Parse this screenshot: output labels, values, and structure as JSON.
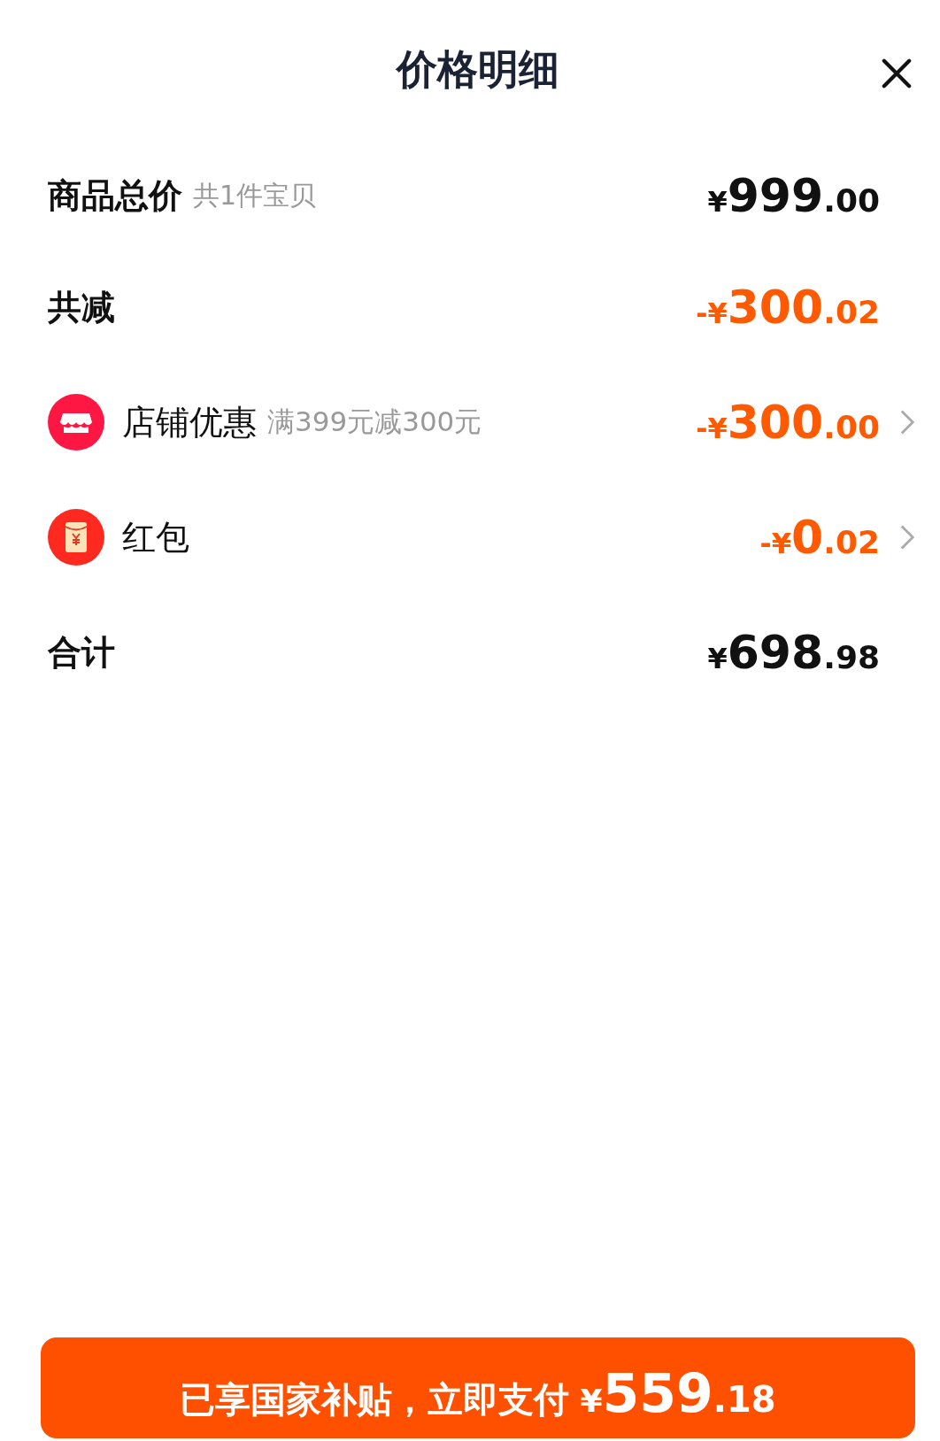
{
  "title": "价格明细",
  "rows": [
    {
      "kind": "plain",
      "label": "商品总价",
      "note": "共1件宝贝",
      "amount": {
        "currency": "¥",
        "integer": "999",
        "decimal": ".00"
      },
      "discount": false,
      "link": false
    },
    {
      "kind": "plain",
      "label": "共减",
      "amount": {
        "sign": "-",
        "currency": "¥",
        "integer": "300",
        "decimal": ".02"
      },
      "discount": true,
      "link": false
    },
    {
      "kind": "store",
      "label": "店铺优惠",
      "note": "满399元减300元",
      "amount": {
        "sign": "-",
        "currency": "¥",
        "integer": "300",
        "decimal": ".00"
      },
      "discount": true,
      "link": true
    },
    {
      "kind": "redpacket",
      "label": "红包",
      "amount": {
        "sign": "-",
        "currency": "¥",
        "integer": "0",
        "decimal": ".02"
      },
      "discount": true,
      "link": true
    },
    {
      "kind": "plain",
      "label": "合计",
      "amount": {
        "currency": "¥",
        "integer": "698",
        "decimal": ".98"
      },
      "discount": false,
      "link": false
    }
  ],
  "pay_button": {
    "label": "已享国家补贴，立即支付",
    "currency": "¥",
    "integer": "559",
    "decimal": ".18"
  }
}
